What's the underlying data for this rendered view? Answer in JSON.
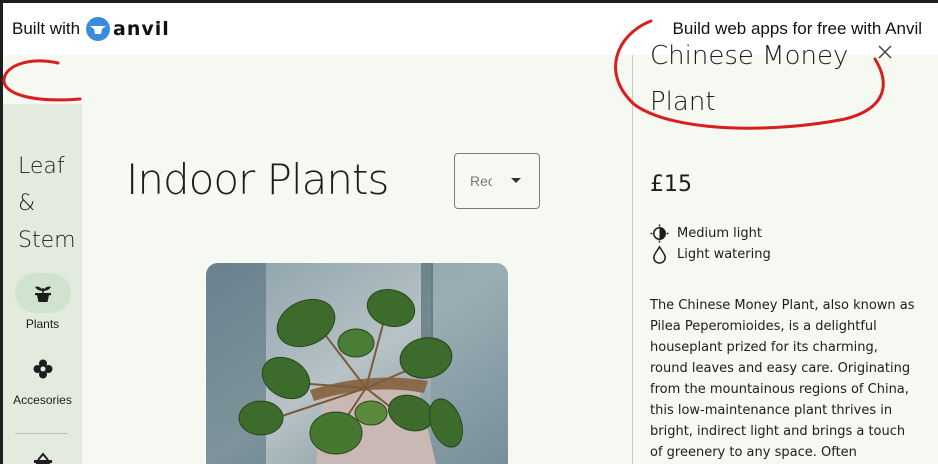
{
  "banner": {
    "built_with": "Built with",
    "logo_text": "anvil",
    "build_link": "Build web apps for free with Anvil"
  },
  "sidebar": {
    "brand_lines": [
      "Leaf",
      "&",
      "Stem"
    ],
    "items": [
      {
        "label": "Plants",
        "icon": "plant-pot-icon",
        "active": true
      },
      {
        "label": "Accesories",
        "icon": "flower-icon",
        "active": false
      },
      {
        "label": "",
        "icon": "basket-icon",
        "active": false
      }
    ]
  },
  "main": {
    "title": "Indoor Plants",
    "sort": {
      "value": "Rec"
    }
  },
  "detail": {
    "title": "Chinese Money Plant",
    "price": "£15",
    "care": [
      {
        "icon": "sun-icon",
        "text": "Medium light"
      },
      {
        "icon": "water-drop-icon",
        "text": "Light watering"
      }
    ],
    "description": "The Chinese Money Plant, also known as Pilea Peperomioides, is a delightful houseplant prized for its charming, round leaves and easy care. Originating from the mountainous regions of China, this low-maintenance plant thrives in bright, indirect light and brings a touch of greenery to any space. Often"
  },
  "colors": {
    "rail_bg": "#e3ebdf",
    "active_pill": "#cfe3cf",
    "annotation_red": "#d81e1e",
    "anvil_blue": "#3a8bd9"
  }
}
